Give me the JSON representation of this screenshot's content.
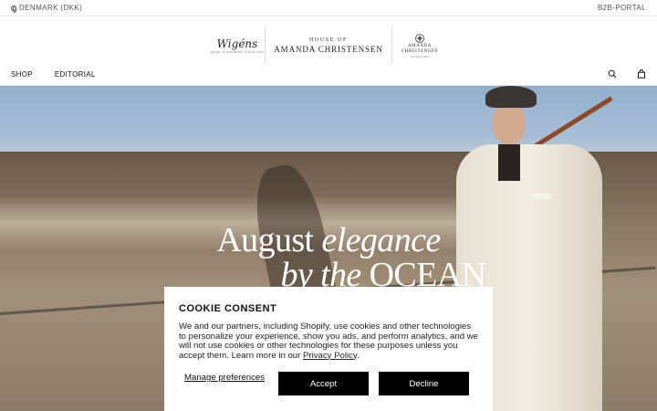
{
  "topbar": {
    "locale": "DENMARK (DKK)",
    "b2b": "B2B-PORTAL"
  },
  "logos": {
    "wigens": {
      "script": "Wigéns",
      "small": "MADE IN DENMARK SINCE 1899"
    },
    "house": {
      "house_of": "HOUSE OF",
      "name": "AMANDA CHRISTENSEN"
    },
    "amanda": {
      "name_line1": "AMANDA",
      "name_line2": "CHRISTENSEN",
      "small": "SINCE 1887"
    }
  },
  "nav": {
    "items": [
      {
        "label": "SHOP"
      },
      {
        "label": "EDITORIAL"
      }
    ]
  },
  "header_icons": [
    "search-icon",
    "shopping-bag-icon"
  ],
  "hero": {
    "line1_a": "August ",
    "line1_b": "elegance",
    "line2_a": "by the ",
    "line2_b": "OCEAN"
  },
  "cookie": {
    "title": "COOKIE CONSENT",
    "body": "We and our partners, including Shopify, use cookies and other technologies to personalize your experience, show you ads, and perform analytics, and we will not use cookies or other technologies for these purposes unless you accept them. Learn more in our ",
    "privacy_link": "Privacy Policy",
    "body_end": ".",
    "manage": "Manage preferences",
    "accept": "Accept",
    "decline": "Decline"
  },
  "colors": {
    "button_bg": "#000000",
    "button_text": "#ffffff",
    "text": "#111111"
  }
}
